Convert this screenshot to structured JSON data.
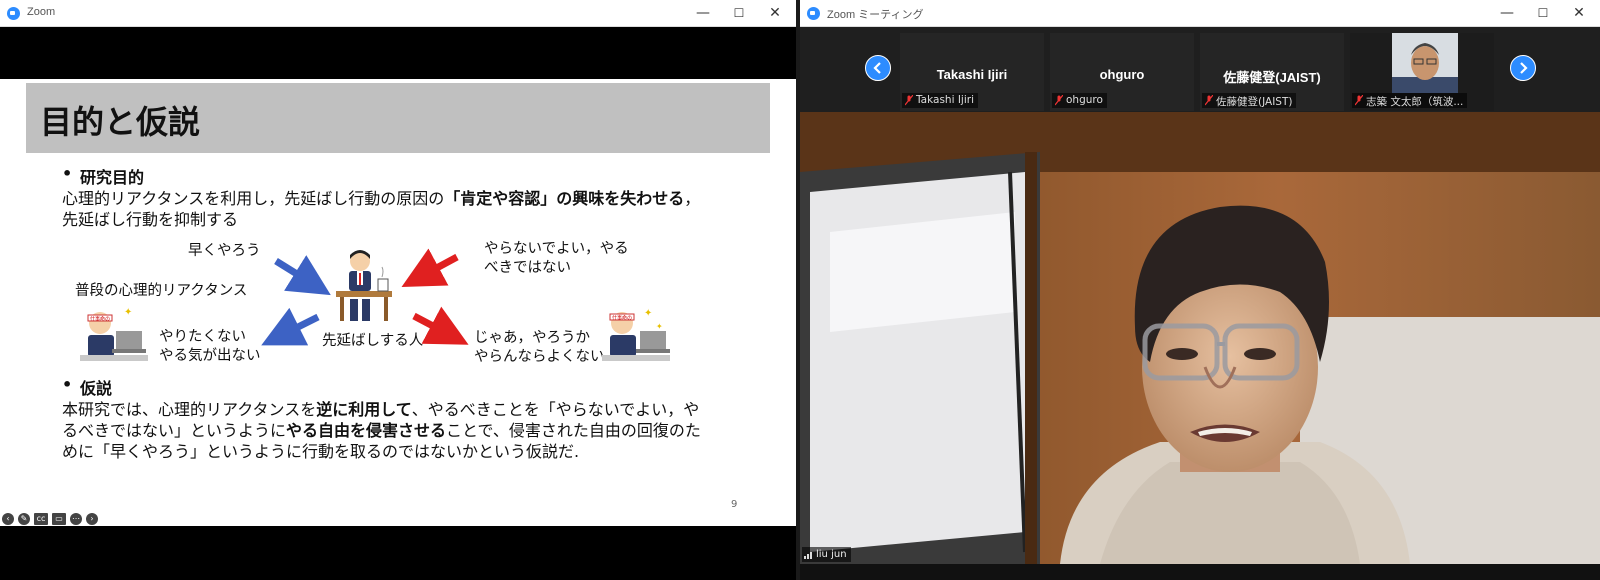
{
  "left_window": {
    "title": "Zoom",
    "controls": {
      "minimize": "—",
      "maximize": "☐",
      "close": "✕"
    },
    "slide": {
      "title": "目的と仮説",
      "bullet1_heading": "研究目的",
      "bullet1_line1_pre": "心理的リアクタンスを利用し，先延ばし行動の原因の",
      "bullet1_line1_bold": "「肯定や容認」の興味を失わせる",
      "bullet1_line1_post": "，",
      "bullet1_line2": "先延ばし行動を抑制する",
      "fig_hayaku": "早くやろう",
      "fig_futsuu": "普段の心理的リアクタンス",
      "fig_yaranai1": "やらないでよい，やる",
      "fig_yaranai2": "べきではない",
      "fig_yaritaku1": "やりたくない",
      "fig_yaritaku2": "やる気が出ない",
      "fig_center": "先延ばしする人",
      "fig_jaa1": "じゃあ，やろうか",
      "fig_jaa2": "やらんならよくない",
      "headband_text": "仕事命の",
      "bullet2_heading": "仮説",
      "hyp_l1_a": "本研究では、心理的リアクタンスを",
      "hyp_l1_b": "逆に利用して",
      "hyp_l1_c": "、やるべきことを「やらないでよい，や",
      "hyp_l2_a": "るべきではない」というように",
      "hyp_l2_b": "やる自由を侵害させる",
      "hyp_l2_c": "ことで、侵害された自由の回復のた",
      "hyp_l3": "めに「早くやろう」というように行動を取るのではないかという仮説だ.",
      "page_number": "9"
    }
  },
  "right_window": {
    "title": "Zoom ミーティング",
    "controls": {
      "minimize": "—",
      "maximize": "☐",
      "close": "✕"
    },
    "participants": [
      {
        "name": "Takashi Ijiri",
        "label": "Takashi Ijiri"
      },
      {
        "name": "ohguro",
        "label": "ohguro"
      },
      {
        "name": "佐藤健登(JAIST)",
        "label": "佐藤健登(JAIST)"
      },
      {
        "name": "",
        "label": "志築 文太郎（筑波..."
      }
    ],
    "active_speaker": "liu jun"
  }
}
